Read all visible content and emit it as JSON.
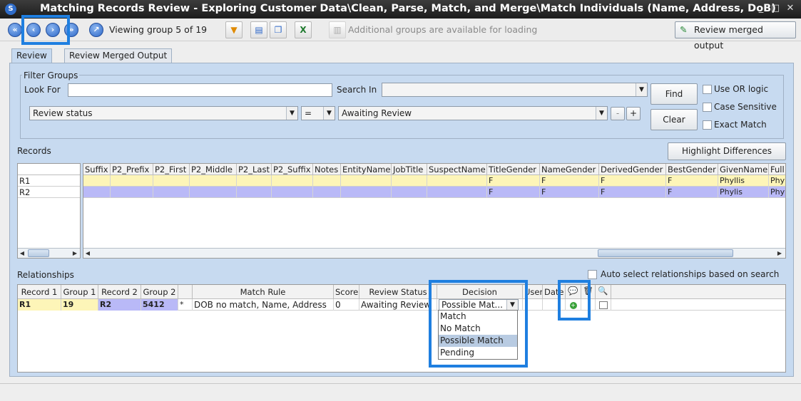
{
  "window": {
    "title": "Matching Records Review - Exploring Customer Data\\Clean, Parse, Match, and Merge\\Match Individuals (Name, Address, DoB)",
    "app_icon": "S"
  },
  "toolbar": {
    "viewing_text": "Viewing group 5 of 19",
    "additional_text": "Additional groups are available for loading",
    "review_merged_label": "Review merged output",
    "icons": [
      "first-icon",
      "prev-icon",
      "next-icon",
      "last-icon",
      "goto-icon",
      "filter-icon",
      "edit-icon",
      "copy-icon",
      "excel-icon",
      "load-icon",
      "review-merged-icon"
    ]
  },
  "tabs": [
    {
      "label": "Review",
      "active": true
    },
    {
      "label": "Review Merged Output",
      "active": false
    }
  ],
  "filter": {
    "group_title": "Filter Groups",
    "look_for_label": "Look For",
    "look_for_value": "",
    "search_in_label": "Search In",
    "search_in_value": "",
    "field_value": "Review status",
    "operator_value": "=",
    "criteria_value": "Awaiting Review",
    "minus_label": "-",
    "plus_label": "+",
    "find_label": "Find",
    "clear_label": "Clear",
    "use_or_label": "Use OR logic",
    "case_sensitive_label": "Case Sensitive",
    "exact_match_label": "Exact Match"
  },
  "records": {
    "title": "Records",
    "highlight_label": "Highlight Differences",
    "row_labels": [
      "R1",
      "R2"
    ],
    "columns": [
      "Suffix",
      "P2_Prefix",
      "P2_First",
      "P2_Middle",
      "P2_Last",
      "P2_Suffix",
      "Notes",
      "EntityName",
      "JobTitle",
      "SuspectName",
      "TitleGender",
      "NameGender",
      "DerivedGender",
      "BestGender",
      "GivenName",
      "Full"
    ],
    "rows": [
      [
        "",
        "",
        "",
        "",
        "",
        "",
        "",
        "",
        "",
        "",
        "F",
        "F",
        "F",
        "F",
        "Phyllis",
        "Phy"
      ],
      [
        "",
        "",
        "",
        "",
        "",
        "",
        "",
        "",
        "",
        "",
        "F",
        "F",
        "F",
        "F",
        "Phylis",
        "Phy"
      ]
    ]
  },
  "relationships": {
    "title": "Relationships",
    "auto_select_label": "Auto select relationships based on search",
    "columns": [
      "Record 1",
      "Group 1",
      "Record 2",
      "Group 2",
      "",
      "Match Rule",
      "Score",
      "Review Status",
      "Decision",
      "User",
      "Date"
    ],
    "row": {
      "record1": "R1",
      "group1": "19",
      "record2": "R2",
      "group2": "5412",
      "marker": "*",
      "match_rule": "DOB no match, Name, Address",
      "score": "0",
      "review_status": "Awaiting Review",
      "decision": "Possible Mat...",
      "user": "",
      "date": ""
    },
    "decision_options": [
      "Match",
      "No Match",
      "Possible Match",
      "Pending"
    ],
    "decision_selected": "Possible Match"
  },
  "colors": {
    "panel": "#c7daf0",
    "record1_row": "#fdf5b8",
    "record2_row": "#b9b9f7",
    "highlight_box": "#1f7fe0"
  }
}
